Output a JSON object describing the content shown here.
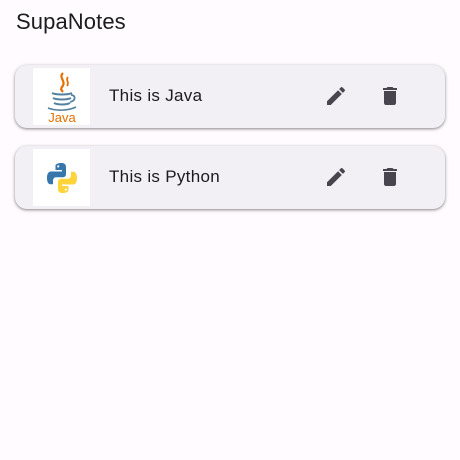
{
  "app": {
    "title": "SupaNotes"
  },
  "notes": [
    {
      "text": "This is Java",
      "image_icon": "java-logo-icon",
      "logo_label": "Java",
      "edit_icon": "pencil-icon",
      "delete_icon": "trash-icon"
    },
    {
      "text": "This is Python",
      "image_icon": "python-logo-icon",
      "edit_icon": "pencil-icon",
      "delete_icon": "trash-icon"
    }
  ],
  "colors": {
    "background": "#fffbfe",
    "card": "#f2f0f5",
    "text": "#1c1b1f",
    "icon": "#49454f",
    "java_red": "#e76f00",
    "java_blue": "#5382a1",
    "python_blue": "#3776ab",
    "python_yellow": "#ffd43b"
  }
}
